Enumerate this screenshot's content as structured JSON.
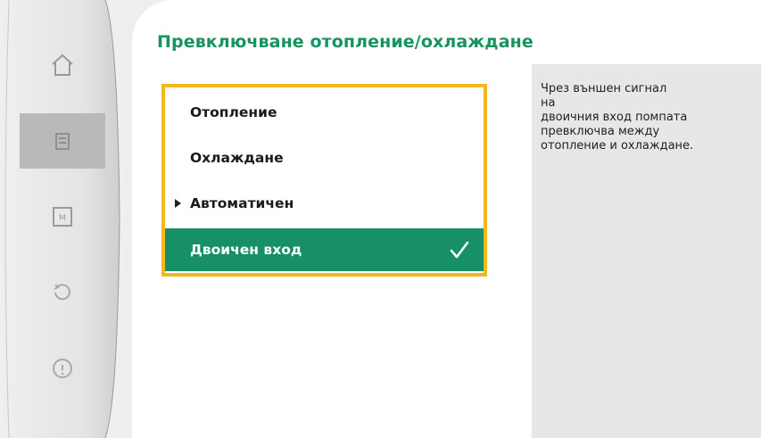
{
  "screen": {
    "title": "Превключване отопление/охлаждане"
  },
  "menu": {
    "items": [
      {
        "label": "Отопление"
      },
      {
        "label": "Охлаждане"
      },
      {
        "label": "Автоматичен"
      },
      {
        "label": "Двоичен вход"
      }
    ],
    "selected_index": 3,
    "cursor_index": 2
  },
  "help": {
    "text": "Чрез външен сигнал\nна\nдвоичния вход помпата\nпревключва между\nотопление и охлаждане."
  },
  "nav": {
    "icons": [
      "home-icon",
      "settings-icon",
      "diagnostics-icon",
      "restore-icon",
      "help-icon"
    ],
    "active_index": 1
  },
  "colors": {
    "title": "#16935f",
    "selected_bg": "#178f69",
    "focus_border": "#f3b81e",
    "help_bg": "#e7e7e7"
  }
}
